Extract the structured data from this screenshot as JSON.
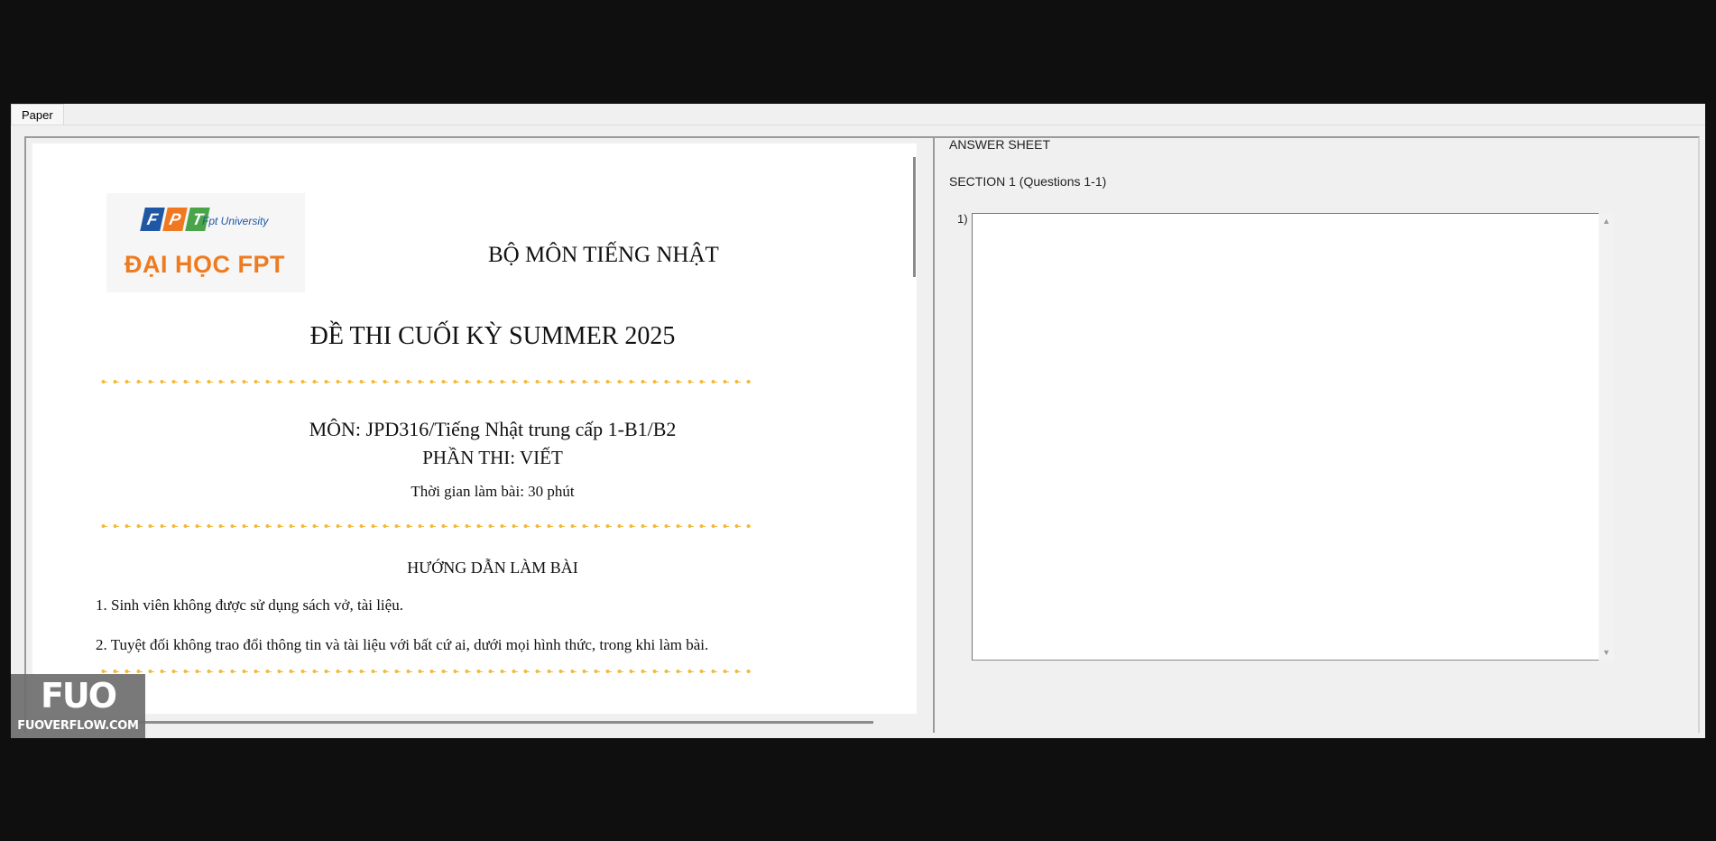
{
  "tabs": [
    {
      "label": "Paper"
    }
  ],
  "paper": {
    "logo": {
      "letters": [
        "F",
        "P",
        "T"
      ],
      "university": "Fpt University",
      "name": "ĐẠI HỌC FPT"
    },
    "department": "BỘ MÔN TIẾNG NHẬT",
    "exam_title": "ĐỀ THI CUỐI KỲ SUMMER 2025",
    "subject": "MÔN: JPD316/Tiếng Nhật trung cấp 1-B1/B2",
    "part": "PHẦN THI: VIẾT",
    "duration": "Thời gian làm bài: 30 phút",
    "guide_title": "HƯỚNG DẪN LÀM BÀI",
    "rules": [
      "1. Sinh viên không được sử dụng sách vở, tài liệu.",
      "2. Tuyệt đối không trao đổi thông tin và tài liệu với bất cứ ai, dưới mọi hình thức, trong khi làm bài."
    ],
    "divider_color": "#f2b93b"
  },
  "answer_sheet": {
    "title": "ANSWER SHEET",
    "section_label": "SECTION 1 (Questions 1-1)",
    "questions": [
      {
        "number": "1)",
        "answer": ""
      }
    ]
  },
  "watermark": {
    "logo": "FUO",
    "url": "FUOVERFLOW.COM"
  }
}
